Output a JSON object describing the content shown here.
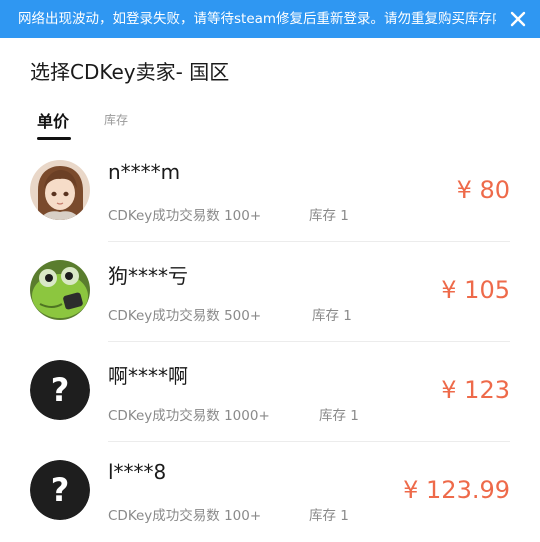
{
  "banner": {
    "text": "网络出现波动，如登录失败，请等待steam修复后重新登录。请勿重复购买库存内",
    "close_icon": "close-icon"
  },
  "page": {
    "title": "选择CDKey卖家- 国区"
  },
  "tabs": [
    {
      "label": "单价",
      "active": true
    },
    {
      "label": "库存",
      "active": false
    }
  ],
  "sellers": [
    {
      "name": "n****m",
      "stats": "CDKey成功交易数  100+",
      "stock": "库存  1",
      "price": "¥ 80",
      "avatar": "anime-girl-avatar"
    },
    {
      "name": "狗****亏",
      "stats": "CDKey成功交易数  500+",
      "stock": "库存  1",
      "price": "¥ 105",
      "avatar": "frog-avatar"
    },
    {
      "name": "啊****啊",
      "stats": "CDKey成功交易数  1000+",
      "stock": "库存  1",
      "price": "¥ 123",
      "avatar": "question-mark-avatar"
    },
    {
      "name": "l****8",
      "stats": "CDKey成功交易数  100+",
      "stock": "库存  1",
      "price": "¥ 123.99",
      "avatar": "question-mark-avatar"
    }
  ],
  "colors": {
    "banner": "#2f97f2",
    "price": "#ee6a4a",
    "muted": "#8a8a8a"
  }
}
